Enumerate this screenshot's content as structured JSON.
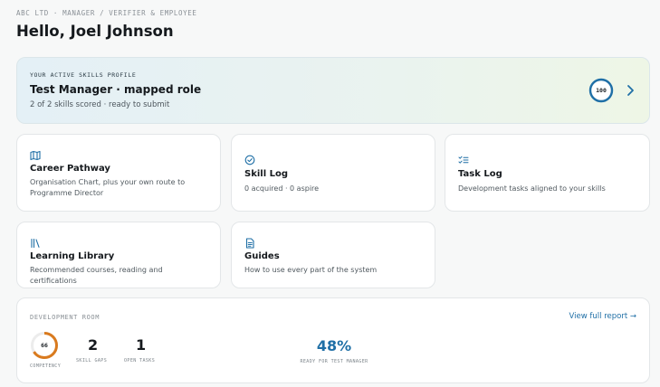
{
  "header": {
    "breadcrumb": "ABC LTD · MANAGER / VERIFIER & EMPLOYEE",
    "greeting": "Hello, Joel Johnson"
  },
  "profile": {
    "eyebrow": "YOUR ACTIVE SKILLS PROFILE",
    "title": "Test Manager · mapped role",
    "subtitle": "2 of 2 skills scored · ready to submit",
    "score": "100",
    "score_fraction": 1.0,
    "accent": "#1f6fa6",
    "icons": {
      "chevron": "chevron-right-icon"
    }
  },
  "tiles": [
    {
      "icon": "map-icon",
      "title": "Career Pathway",
      "desc": "Organisation Chart, plus your own route to Programme Director"
    },
    {
      "icon": "check-circle-icon",
      "title": "Skill Log",
      "desc": "0 acquired · 0 aspire"
    },
    {
      "icon": "checklist-icon",
      "title": "Task Log",
      "desc": "Development tasks aligned to your skills"
    },
    {
      "icon": "library-icon",
      "title": "Learning Library",
      "desc": "Recommended courses, reading and certifications"
    },
    {
      "icon": "document-icon",
      "title": "Guides",
      "desc": "How to use every part of the system"
    }
  ],
  "development_room": {
    "eyebrow": "DEVELOPMENT ROOM",
    "link": "View full report →",
    "competency": {
      "value": "66",
      "fraction": 0.66,
      "label": "COMPETENCY",
      "color": "#d97a1e"
    },
    "skill_gaps": {
      "value": "2",
      "label": "SKILL GAPS"
    },
    "open_tasks": {
      "value": "1",
      "label": "OPEN TASKS"
    },
    "ready": {
      "value": "48%",
      "label": "READY FOR TEST MANAGER"
    }
  }
}
